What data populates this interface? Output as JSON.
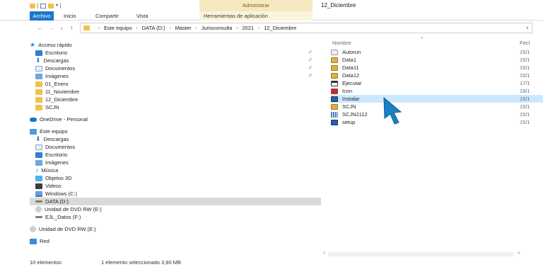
{
  "window": {
    "title": "12_Diciembre",
    "context_group": "Administrar"
  },
  "ribbon": {
    "tabs": [
      "Archivo",
      "Inicio",
      "Compartir",
      "Vista",
      "Herramientas de aplicación"
    ]
  },
  "address": {
    "back_icon": "back-arrow-icon",
    "crumbs": [
      "Este equipo",
      "DATA (D:)",
      "Master",
      "Jurisconsulta",
      "2021",
      "12_Diciembre"
    ]
  },
  "navpane": {
    "items": [
      {
        "label": "Acceso rápido",
        "icon": "star-icon",
        "pinned": false
      },
      {
        "label": "Escritorio",
        "icon": "desktop-icon",
        "pinned": true
      },
      {
        "label": "Descargas",
        "icon": "download-icon",
        "pinned": true
      },
      {
        "label": "Documentos",
        "icon": "document-icon",
        "pinned": true
      },
      {
        "label": "Imágenes",
        "icon": "pictures-icon",
        "pinned": true
      },
      {
        "label": "01_Enero",
        "icon": "folder-icon",
        "pinned": false
      },
      {
        "label": "11_Noviembre",
        "icon": "folder-icon",
        "pinned": false
      },
      {
        "label": "12_Diciembre",
        "icon": "folder-icon",
        "pinned": false
      },
      {
        "label": "SCJN",
        "icon": "folder-icon",
        "pinned": false
      },
      {
        "label": "OneDrive - Personal",
        "icon": "cloud-icon",
        "pinned": false
      },
      {
        "label": "Este equipo",
        "icon": "pc-icon",
        "pinned": false
      },
      {
        "label": "Descargas",
        "icon": "download-icon",
        "pinned": false
      },
      {
        "label": "Documentos",
        "icon": "document-icon",
        "pinned": false
      },
      {
        "label": "Escritorio",
        "icon": "desktop-icon",
        "pinned": false
      },
      {
        "label": "Imágenes",
        "icon": "pictures-icon",
        "pinned": false
      },
      {
        "label": "Música",
        "icon": "music-icon",
        "pinned": false
      },
      {
        "label": "Objetos 3D",
        "icon": "3d-objects-icon",
        "pinned": false
      },
      {
        "label": "Videos",
        "icon": "video-icon",
        "pinned": false
      },
      {
        "label": "Windows (C:)",
        "icon": "windows-drive-icon",
        "pinned": false
      },
      {
        "label": "DATA (D:)",
        "icon": "drive-icon",
        "pinned": false,
        "selected": true
      },
      {
        "label": "Unidad de DVD RW (E:)",
        "icon": "dvd-icon",
        "pinned": false
      },
      {
        "label": "EJL_Datos (F:)",
        "icon": "drive-icon",
        "pinned": false
      },
      {
        "label": "Unidad de DVD RW (E:)",
        "icon": "dvd-icon",
        "pinned": false
      },
      {
        "label": "Red",
        "icon": "network-icon",
        "pinned": false
      }
    ]
  },
  "content": {
    "columns": {
      "name": "Nombre",
      "date": "Fecl"
    },
    "files": [
      {
        "name": "Autorun",
        "date": "15/1",
        "icon": "text-file-icon"
      },
      {
        "name": "Data1",
        "date": "15/1",
        "icon": "database-file-icon"
      },
      {
        "name": "Data11",
        "date": "15/1",
        "icon": "database-file-icon"
      },
      {
        "name": "Data12",
        "date": "15/1",
        "icon": "database-file-icon"
      },
      {
        "name": "Ejecutar",
        "date": "17/1",
        "icon": "executable-icon"
      },
      {
        "name": "Icon",
        "date": "19/1",
        "icon": "image-icon"
      },
      {
        "name": "Instalar",
        "date": "15/1",
        "icon": "installer-icon",
        "selected": true
      },
      {
        "name": "SCJN",
        "date": "15/1",
        "icon": "database-file-icon"
      },
      {
        "name": "SCJN2112",
        "date": "15/1",
        "icon": "grid-file-icon"
      },
      {
        "name": "setup",
        "date": "15/1",
        "icon": "installer-icon"
      }
    ]
  },
  "status": {
    "count": "10 elementos",
    "selected": "1 elemento seleccionado  3,90 MB"
  },
  "colors": {
    "accent": "#1979ca",
    "selected_row": "#cce8ff",
    "context_tab": "#f6e8c0",
    "cursor": "#1a7fc4"
  }
}
